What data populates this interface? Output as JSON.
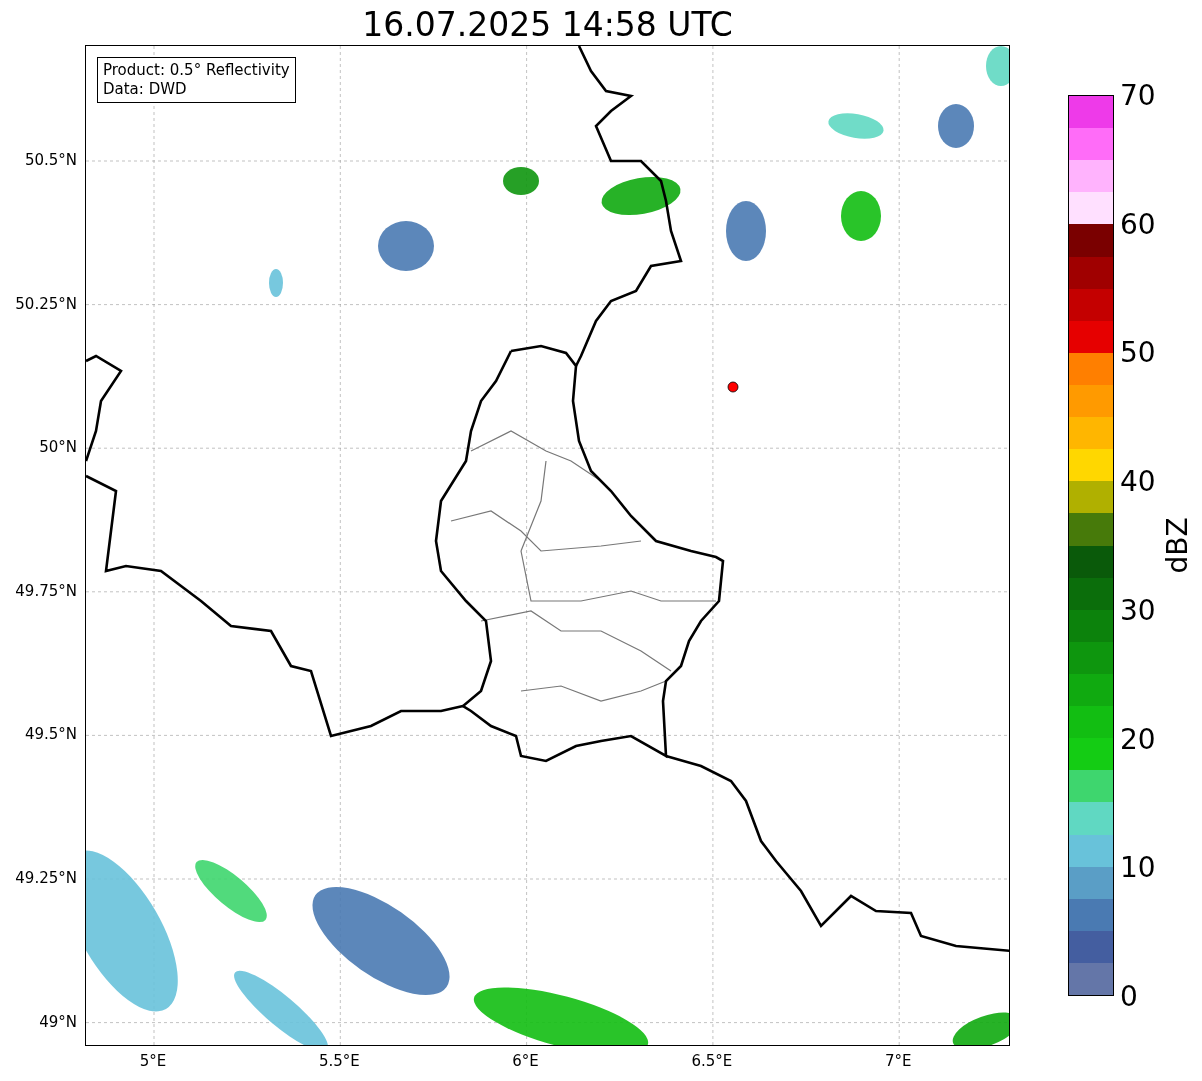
{
  "title": "16.07.2025 14:58 UTC",
  "info_box": [
    "Product: 0.5° Reflectivity",
    "Data: DWD"
  ],
  "y_ticks": [
    "50.5°N",
    "50.25°N",
    "50°N",
    "49.75°N",
    "49.5°N",
    "49.25°N",
    "49°N"
  ],
  "x_ticks": [
    "5°E",
    "5.5°E",
    "6°E",
    "6.5°E",
    "7°E"
  ],
  "colorbar": {
    "label": "dBZ",
    "ticks": [
      "70",
      "60",
      "50",
      "40",
      "30",
      "20",
      "10",
      "0"
    ],
    "bins": [
      {
        "color": "#ee3ae9"
      },
      {
        "color": "#ff6cf8"
      },
      {
        "color": "#ffb3fd"
      },
      {
        "color": "#ffe0ff"
      },
      {
        "color": "#7a0000"
      },
      {
        "color": "#a00000"
      },
      {
        "color": "#c40000"
      },
      {
        "color": "#e60000"
      },
      {
        "color": "#ff7f00"
      },
      {
        "color": "#ff9a00"
      },
      {
        "color": "#ffb600"
      },
      {
        "color": "#ffd700"
      },
      {
        "color": "#b0b000"
      },
      {
        "color": "#477a0a"
      },
      {
        "color": "#0a5a0a"
      },
      {
        "color": "#0b6e0b"
      },
      {
        "color": "#0c820c"
      },
      {
        "color": "#0e960e"
      },
      {
        "color": "#10aa10"
      },
      {
        "color": "#12be12"
      },
      {
        "color": "#14cc14"
      },
      {
        "color": "#3ed66e"
      },
      {
        "color": "#60d8c2"
      },
      {
        "color": "#68c2da"
      },
      {
        "color": "#5a9ec6"
      },
      {
        "color": "#4a7ab2"
      },
      {
        "color": "#445ea0"
      },
      {
        "color": "#6476a8"
      }
    ]
  }
}
